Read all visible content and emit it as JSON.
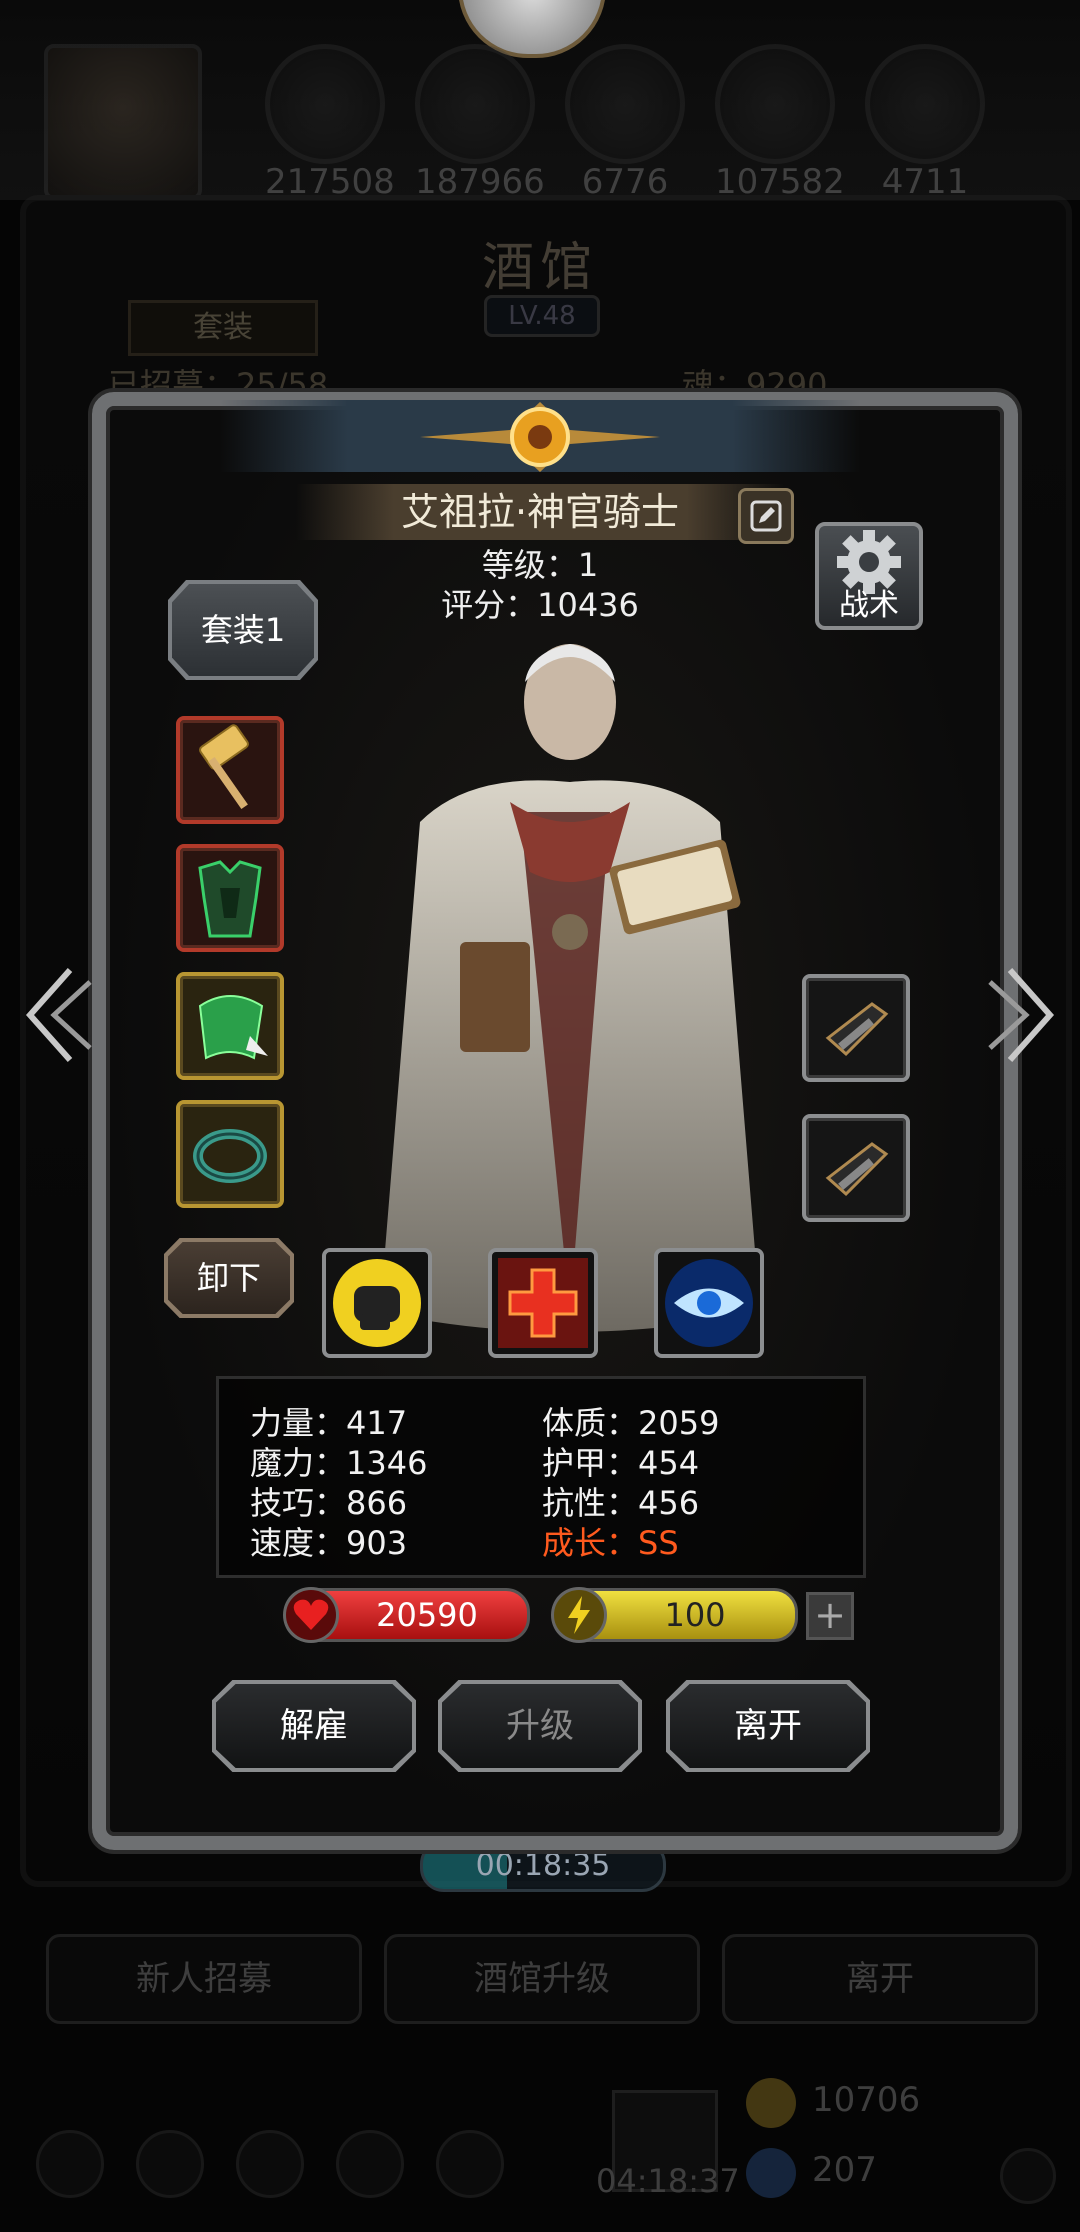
{
  "resources": [
    "217508",
    "187966",
    "6776",
    "107582",
    "4711"
  ],
  "tavern": {
    "title": "酒馆",
    "level": "LV.48",
    "tab_label": "套装",
    "roster_text": "已招募：25/58",
    "soul_text": "魂：9290",
    "timer": "00:18:35",
    "buttons": [
      "新人招募",
      "酒馆升级",
      "离开"
    ],
    "bottom": {
      "countdown": "04:18:37",
      "coins": "10706",
      "gems": "207"
    }
  },
  "hero": {
    "name": "艾祖拉·神官骑士",
    "level_text": "等级：1",
    "score_text": "评分：10436",
    "set_label": "套装1",
    "tactics_label": "战术",
    "unequip_label": "卸下",
    "equipment": [
      {
        "icon": "hammer-icon",
        "border": "red"
      },
      {
        "icon": "armor-icon",
        "border": "red"
      },
      {
        "icon": "cloak-icon",
        "border": "gold"
      },
      {
        "icon": "ring-icon",
        "border": "gold"
      }
    ],
    "side_slots": [
      "bracer-icon",
      "bracer-icon"
    ],
    "skills": [
      "fist-icon",
      "heal-cross-icon",
      "eye-icon"
    ],
    "stats": [
      {
        "label": "力量：417"
      },
      {
        "label": "体质：2059"
      },
      {
        "label": "魔力：1346"
      },
      {
        "label": "护甲：454"
      },
      {
        "label": "技巧：866"
      },
      {
        "label": "抗性：456"
      },
      {
        "label": "速度：903"
      },
      {
        "label": "成长：SS",
        "color": "#ff5a1e"
      }
    ],
    "hp": "20590",
    "energy": "100",
    "plus": "+"
  },
  "dialog_buttons": {
    "dismiss": "解雇",
    "upgrade": "升级",
    "leave": "离开"
  }
}
